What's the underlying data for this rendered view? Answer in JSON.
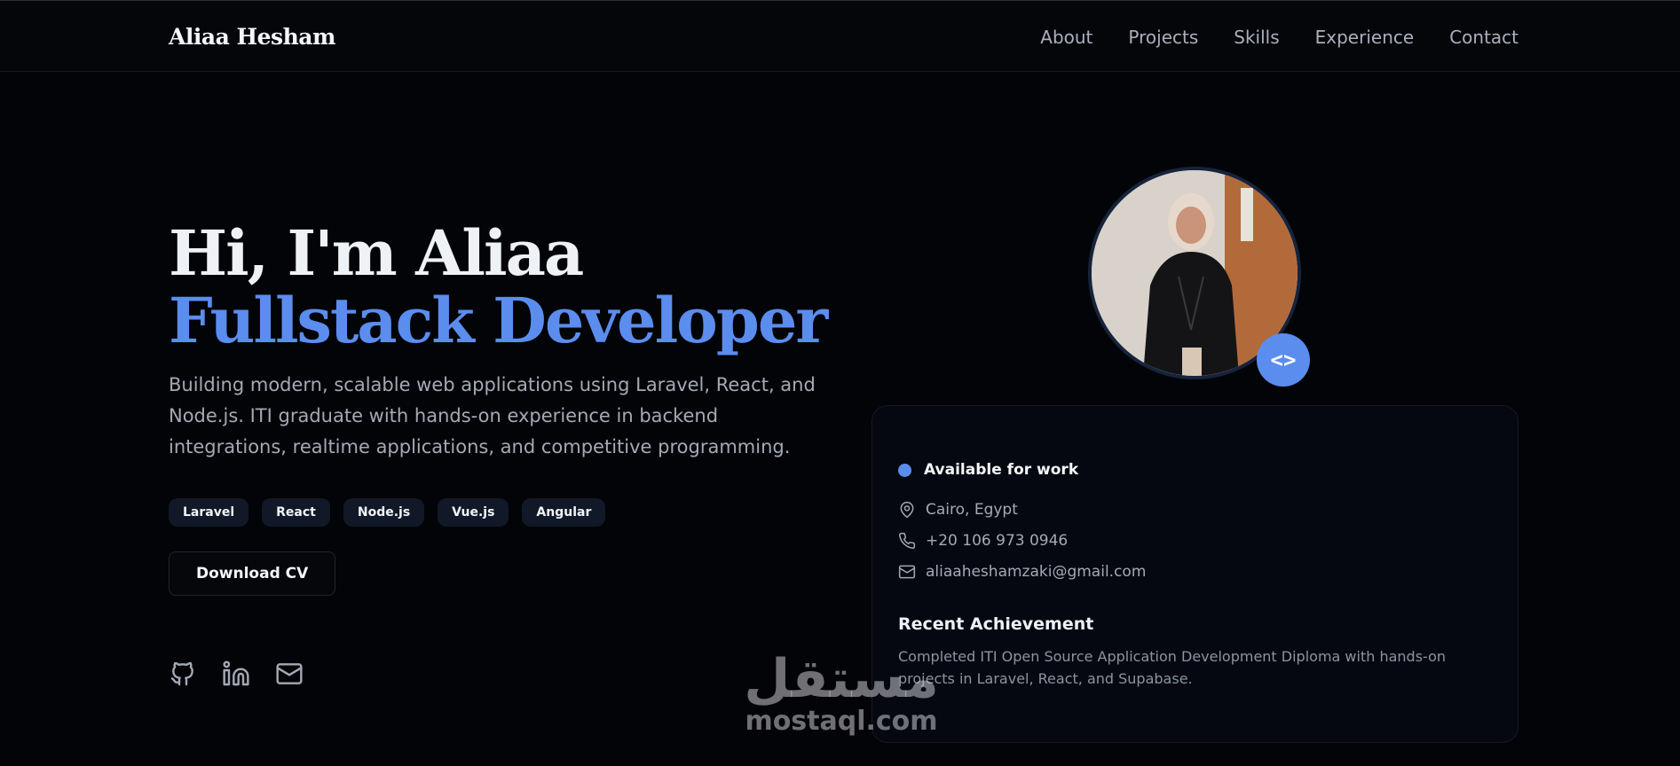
{
  "header": {
    "brand": "Aliaa Hesham",
    "nav": [
      "About",
      "Projects",
      "Skills",
      "Experience",
      "Contact"
    ]
  },
  "hero": {
    "greeting": "Hi, I'm Aliaa",
    "role": "Fullstack Developer",
    "description": "Building modern, scalable web applications using Laravel, React, and Node.js. ITI graduate with hands-on experience in backend integrations, realtime applications, and competitive programming.",
    "skills": [
      "Laravel",
      "React",
      "Node.js",
      "Vue.js",
      "Angular"
    ],
    "cv_button": "Download CV",
    "socials": [
      "github-icon",
      "linkedin-icon",
      "mail-icon"
    ]
  },
  "profile": {
    "photo_alt": "profile-photo",
    "badge_icon": "code-icon",
    "badge_text": "<>"
  },
  "card": {
    "status": "Available for work",
    "location": "Cairo, Egypt",
    "phone": "+20 106 973 0946",
    "email": "aliaaheshamzaki@gmail.com",
    "achievement_title": "Recent Achievement",
    "achievement_text": "Completed ITI Open Source Application Development Diploma with hands-on projects in Laravel, React, and Supabase."
  },
  "watermark": {
    "arabic": "مستقل",
    "latin": "mostaql.com"
  },
  "colors": {
    "background": "#030407",
    "accent": "#5b8def",
    "text_muted": "#a3aab6"
  }
}
